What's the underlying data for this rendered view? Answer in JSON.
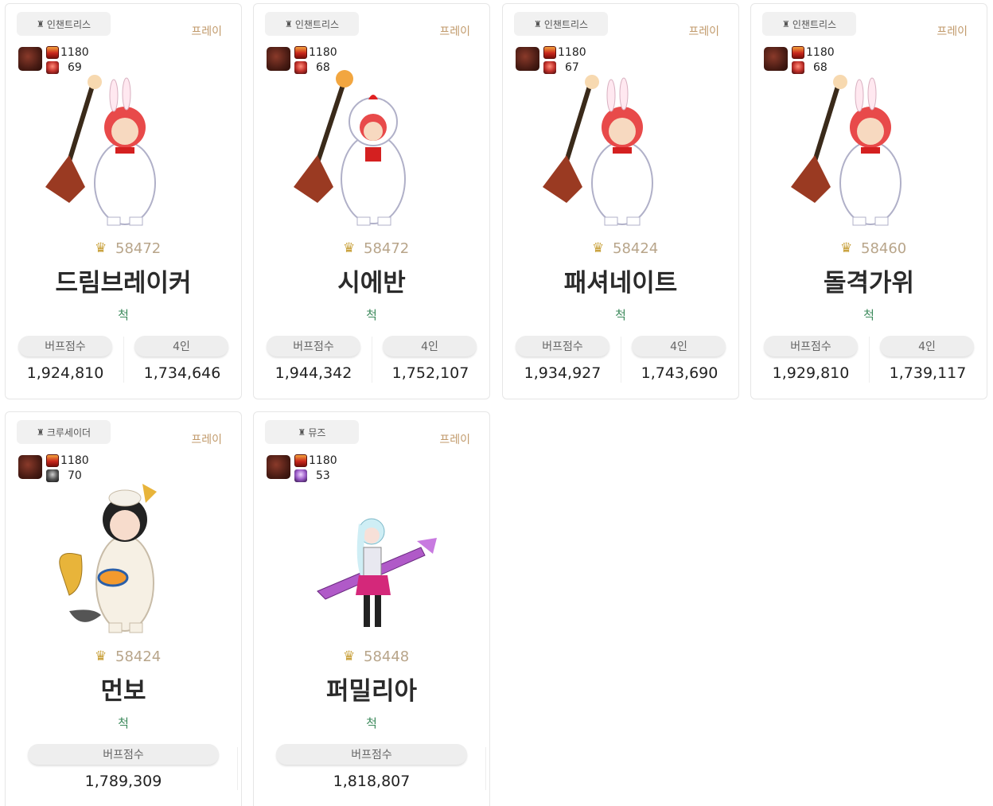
{
  "cards": [
    {
      "class_badge": "인챈트리스",
      "play_label": "프레이",
      "gear_level": "1180",
      "level": "69",
      "rank_score": "58472",
      "name": "드림브레이커",
      "server": "척",
      "stats": [
        {
          "label": "버프점수",
          "value": "1,924,810"
        },
        {
          "label": "4인",
          "value": "1,734,646"
        }
      ]
    },
    {
      "class_badge": "인챈트리스",
      "play_label": "프레이",
      "gear_level": "1180",
      "level": "68",
      "rank_score": "58472",
      "name": "시에반",
      "server": "척",
      "stats": [
        {
          "label": "버프점수",
          "value": "1,944,342"
        },
        {
          "label": "4인",
          "value": "1,752,107"
        }
      ]
    },
    {
      "class_badge": "인챈트리스",
      "play_label": "프레이",
      "gear_level": "1180",
      "level": "67",
      "rank_score": "58424",
      "name": "패셔네이트",
      "server": "척",
      "stats": [
        {
          "label": "버프점수",
          "value": "1,934,927"
        },
        {
          "label": "4인",
          "value": "1,743,690"
        }
      ]
    },
    {
      "class_badge": "인챈트리스",
      "play_label": "프레이",
      "gear_level": "1180",
      "level": "68",
      "rank_score": "58460",
      "name": "돌격가위",
      "server": "척",
      "stats": [
        {
          "label": "버프점수",
          "value": "1,929,810"
        },
        {
          "label": "4인",
          "value": "1,739,117"
        }
      ]
    },
    {
      "class_badge": "크루세이더",
      "play_label": "프레이",
      "gear_level": "1180",
      "level": "70",
      "rank_score": "58424",
      "name": "먼보",
      "server": "척",
      "stats": [
        {
          "label": "버프점수",
          "value": "1,789,309"
        }
      ]
    },
    {
      "class_badge": "뮤즈",
      "play_label": "프레이",
      "gear_level": "1180",
      "level": "53",
      "rank_score": "58448",
      "name": "퍼밀리아",
      "server": "척",
      "stats": [
        {
          "label": "버프점수",
          "value": "1,818,807"
        }
      ]
    }
  ],
  "colors": {
    "play_label": "#c19a6b",
    "server": "#3d8a5c",
    "rank_score": "#b8a58a",
    "pill_bg": "#eeeeee"
  },
  "icons": {
    "badge": "medal-icon",
    "gear": "gear-level-icon",
    "level": "character-level-icon",
    "rank": "rank-crest-icon",
    "avatar": "adventurer-avatar"
  }
}
